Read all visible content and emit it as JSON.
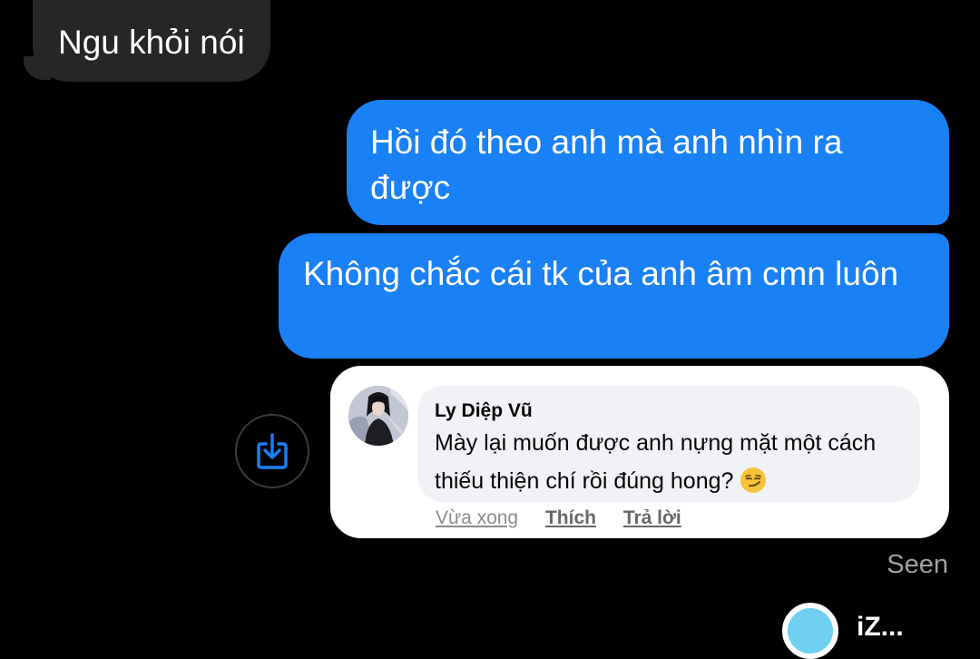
{
  "messages": {
    "received": [
      {
        "text": "Ngu khỏi nói"
      }
    ],
    "sent": [
      {
        "text": "Hồi đó theo anh mà anh nhìn ra được"
      },
      {
        "text": "Không chắc cái tk của anh âm cmn luôn"
      }
    ]
  },
  "shared_comment": {
    "author": "Ly Diệp Vũ",
    "text": "Mày lại muốn được anh nựng mặt một cách thiếu thiện chí rồi đúng hong?",
    "emoji": "smirking-face",
    "actions": {
      "time": "Vừa xong",
      "like": "Thích",
      "reply": "Trả lời"
    }
  },
  "status": {
    "seen": "Seen"
  },
  "watermark": {
    "text": "iZ..."
  },
  "colors": {
    "background": "#000000",
    "received_bubble": "#262628",
    "sent_bubble": "#1a80f5",
    "share_icon": "#1a80f5",
    "seen_text": "#a0a0a5"
  },
  "icons": {
    "share": "share-download-icon"
  }
}
